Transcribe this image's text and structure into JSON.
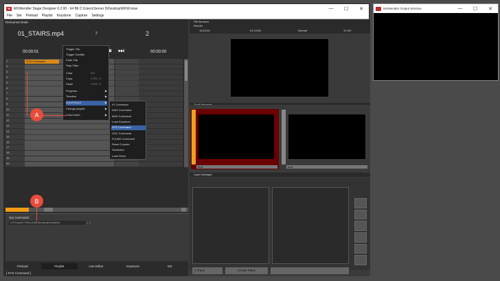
{
  "main_window": {
    "logo": "M",
    "title": "MXWendler Stage Designer 6.2.00 - 64 Bit C:\\Users\\Server 9\\Desktop\\MXW.mxw",
    "controls": [
      "—",
      "☐",
      "✕"
    ]
  },
  "menu": [
    "File",
    "Set",
    "Preload",
    "Playlist",
    "Keystone",
    "Capture",
    "Settings"
  ],
  "left_panel": {
    "mode": "Rehearsal Mode",
    "clip_name": "01_STAIRS.mp4",
    "num_a": "2",
    "num_b": "2",
    "tc_left": "00:00:01",
    "tc_right": "00:00:00",
    "transport": [
      "⏮",
      "⏪",
      "▶",
      "⏩",
      "⏸",
      "⏭"
    ],
    "grid_rows": [
      "1",
      "2",
      "3",
      "4",
      "5",
      "6",
      "7",
      "8",
      "9",
      "10",
      "11",
      "12",
      "13",
      "14",
      "15",
      "16",
      "17",
      "18",
      "19",
      "20"
    ],
    "sys_cell": "SYS Command"
  },
  "context_menu": [
    {
      "label": "Trigger Clip",
      "shortcut": "",
      "arrow": ""
    },
    {
      "label": "Trigger Subtitle",
      "shortcut": "",
      "arrow": ""
    },
    {
      "label": "Fade Clip",
      "shortcut": "",
      "arrow": ""
    },
    {
      "label": "Stop Clips",
      "shortcut": "",
      "arrow": ""
    },
    {
      "label": "Clear",
      "shortcut": "Del",
      "arrow": ""
    },
    {
      "label": "Copy",
      "shortcut": "CTRL+C",
      "arrow": ""
    },
    {
      "label": "Paste",
      "shortcut": "CTRL+V",
      "arrow": ""
    },
    {
      "label": "Progress",
      "shortcut": "",
      "arrow": "▶"
    },
    {
      "label": "Timeline",
      "shortcut": "",
      "arrow": "▶"
    },
    {
      "label": "Input/Output",
      "shortcut": "",
      "arrow": "▶"
    },
    {
      "label": "Change playlist",
      "shortcut": "",
      "arrow": "▶"
    },
    {
      "label": "Color/Label",
      "shortcut": "",
      "arrow": "▶"
    }
  ],
  "submenu": [
    "IO Command",
    "DMX Command",
    "MIDI Command",
    "Load Keystone",
    "SYS Command",
    "OSC Command",
    "PJLINK Command",
    "Reset Counter",
    "Shutdown",
    "Load Show"
  ],
  "callouts": {
    "a": "A",
    "b": "B"
  },
  "sys_panel": {
    "label": "Sys command:",
    "path": "c:\\Program Files (x86)\\Audacity\\Audacity",
    "dots": "[...]"
  },
  "tabs": [
    "Preload",
    "Playlist",
    "Live Editor",
    "Keystone",
    "Set"
  ],
  "status": "[ SYS Command ]",
  "right_panel": {
    "file_browser": "File Browser",
    "render": "Render",
    "render_time": "15:24:04",
    "render_tc": "01:19:36",
    "render_mode": "Normal",
    "render_zoom": "% 100",
    "track_manager": "Track Manager",
    "fade_a": "fade",
    "fade_b": "fade",
    "layer_manager": "Layer Manager",
    "btn_track": "1 Track",
    "btn_patch": "Create Patch"
  },
  "output_window": {
    "title": "MXWendler Output Window",
    "controls": [
      "—",
      "☐",
      "✕"
    ]
  }
}
